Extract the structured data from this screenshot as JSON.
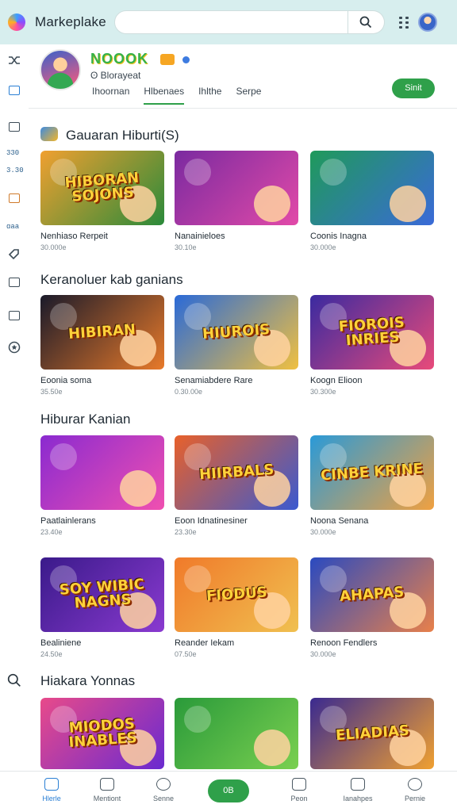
{
  "app": {
    "title": "Markeplake",
    "logo_icon": "app-logo-icon"
  },
  "search": {
    "placeholder": "",
    "button_icon": "search-icon"
  },
  "channel": {
    "name": "NOOOK",
    "handle": "ʘ Blorayeat",
    "tabs": [
      {
        "label": "Ihoornan",
        "active": false
      },
      {
        "label": "Hlbenaes",
        "active": true
      },
      {
        "label": "Ihlthe",
        "active": false
      },
      {
        "label": "Serpe",
        "active": false
      }
    ],
    "subscribe_label": "Sinit"
  },
  "rail": {
    "texts": [
      "330",
      "3.30",
      "ɑaa"
    ],
    "icons": [
      "shuffle-icon",
      "home-square-icon",
      "keyboard-icon",
      "calendar-icon",
      "tag-icon",
      "play-square-icon",
      "ticket-icon",
      "star-circle-icon",
      "search-icon"
    ]
  },
  "sections": [
    {
      "title": "Gauaran Hiburti(S)",
      "cards": [
        {
          "title": "Nenhiaso Rerpeit",
          "meta": "30.000e",
          "thumb_text": "HIBORAN SOJONS",
          "colors": [
            "#f0a030",
            "#2a8a3a"
          ]
        },
        {
          "title": "Nanainieloes",
          "meta": "30.10e",
          "thumb_text": "",
          "colors": [
            "#7a2aa0",
            "#e24aa8"
          ]
        },
        {
          "title": "Coonis Inagna",
          "meta": "30.000e",
          "thumb_text": "",
          "colors": [
            "#1f9a5a",
            "#3a6ad8"
          ]
        }
      ]
    },
    {
      "title": "Keranoluer kab ganians",
      "cards": [
        {
          "title": "Eoonia soma",
          "meta": "35.50e",
          "thumb_text": "HIBIRAN",
          "colors": [
            "#1a1a2a",
            "#e87a2a"
          ]
        },
        {
          "title": "Senamiabdere Rare",
          "meta": "0.30.00e",
          "thumb_text": "HIUROIS",
          "colors": [
            "#2a6ad8",
            "#f0c040"
          ]
        },
        {
          "title": "Koogn Elioon",
          "meta": "30.300e",
          "thumb_text": "FIOROIS INRIES",
          "colors": [
            "#3a2aa0",
            "#e84a7a"
          ]
        }
      ]
    },
    {
      "title": "Hiburar Kanian",
      "cards": [
        {
          "title": "Paatlainlerans",
          "meta": "23.40e",
          "thumb_text": "",
          "colors": [
            "#8a2ad0",
            "#f050b0"
          ]
        },
        {
          "title": "Eoon Idnatinesiner",
          "meta": "23.30e",
          "thumb_text": "HIIRBALS",
          "colors": [
            "#e8602a",
            "#3a5ad0"
          ]
        },
        {
          "title": "Noona Senana",
          "meta": "30.000e",
          "thumb_text": "CINBE KRINE",
          "colors": [
            "#2a9ad8",
            "#f0a040"
          ]
        }
      ]
    },
    {
      "title": "",
      "cards": [
        {
          "title": "Bealiniene",
          "meta": "24.50e",
          "thumb_text": "SOY WIBIC NAGNS",
          "colors": [
            "#3a1a8a",
            "#8a3ad0"
          ]
        },
        {
          "title": "Reander Iekam",
          "meta": "07.50e",
          "thumb_text": "FIODUS",
          "colors": [
            "#f07a2a",
            "#f0c050"
          ]
        },
        {
          "title": "Renoon Fendlers",
          "meta": "30.000e",
          "thumb_text": "AHAPAS",
          "colors": [
            "#2a4ac0",
            "#e8804a"
          ]
        }
      ]
    },
    {
      "title": "Hiakara Yonnas",
      "cards": [
        {
          "title": "",
          "meta": "",
          "thumb_text": "MIODOS INABLES",
          "colors": [
            "#e84a8a",
            "#6a2ad0"
          ]
        },
        {
          "title": "",
          "meta": "",
          "thumb_text": "",
          "colors": [
            "#2a9a3a",
            "#7ad050"
          ]
        },
        {
          "title": "",
          "meta": "",
          "thumb_text": "ELIADIAS",
          "colors": [
            "#3a2a90",
            "#f0a030"
          ]
        }
      ]
    }
  ],
  "bottom_nav": {
    "items": [
      {
        "label": "Hlerle",
        "icon": "home-icon",
        "active": true
      },
      {
        "label": "Mentiont",
        "icon": "box-icon",
        "active": false
      },
      {
        "label": "Senne",
        "icon": "chat-icon",
        "active": false
      },
      {
        "label": "Peon",
        "icon": "message-icon",
        "active": false
      },
      {
        "label": "Ianahpes",
        "icon": "tag-icon",
        "active": false
      },
      {
        "label": "Pernie",
        "icon": "profile-icon",
        "active": false
      }
    ],
    "center_label": "0B"
  }
}
